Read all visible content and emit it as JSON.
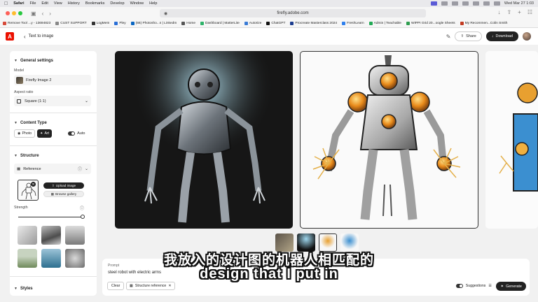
{
  "menubar": {
    "app": "Safari",
    "items": [
      "File",
      "Edit",
      "View",
      "History",
      "Bookmarks",
      "Develop",
      "Window",
      "Help"
    ],
    "datetime": "Wed Mar 27 1:03"
  },
  "browser": {
    "url": "firefly.adobe.com"
  },
  "bookmarks": [
    {
      "label": "Remove Tool ...y - 13694823",
      "color": "#d64a3a"
    },
    {
      "label": "CUST SUPPORT",
      "color": "#888888"
    },
    {
      "label": "LogMeIn",
      "color": "#333333"
    },
    {
      "label": "Pley",
      "color": "#2a6fd6"
    },
    {
      "label": "(66) Photosho...s | LinkedIn",
      "color": "#0a66c2"
    },
    {
      "label": "Home",
      "color": "#555555"
    },
    {
      "label": "Dashboard | MatterLite",
      "color": "#2fb36a"
    },
    {
      "label": "Autorize",
      "color": "#3a7bd5"
    },
    {
      "label": "ChatGPT",
      "color": "#111111"
    },
    {
      "label": "Procreate Masterclass 2024",
      "color": "#1d3d8f"
    },
    {
      "label": "FreshLearn",
      "color": "#2f80ed"
    },
    {
      "label": "Admin | Teachable",
      "color": "#22aa55"
    },
    {
      "label": "WIPPI Grid 20...oogle Sheets",
      "color": "#2e9d4f"
    },
    {
      "label": "My Recommen...Colin Smith",
      "color": "#c23b22"
    }
  ],
  "header": {
    "logo_letter": "A",
    "back_label": "Text to image",
    "share_label": "Share",
    "download_label": "Download"
  },
  "panel": {
    "general_title": "General settings",
    "model_label": "Model",
    "model_value": "Firefly Image 2",
    "aspect_label": "Aspect ratio",
    "aspect_value": "Square (1:1)",
    "content_title": "Content Type",
    "photo_label": "Photo",
    "art_label": "Art",
    "auto_label": "Auto",
    "structure_title": "Structure",
    "reference_label": "Reference",
    "upload_label": "Upload image",
    "gallery_label": "Browse gallery",
    "strength_label": "Strength",
    "strength_value": 1.0,
    "styles_title": "Styles"
  },
  "prompt": {
    "label": "Prompt",
    "text": "steel robot with electric arms",
    "clear_label": "Clear",
    "chip_label": "Structure reference",
    "suggestions_label": "Suggestions",
    "generate_label": "Generate"
  },
  "subtitles": {
    "zh": "我放入的设计图的机器人相匹配的",
    "en": "design that I put in"
  },
  "colors": {
    "accent_dark": "#222222",
    "adobe_red": "#eb1000",
    "bg": "#f1f1f1"
  }
}
